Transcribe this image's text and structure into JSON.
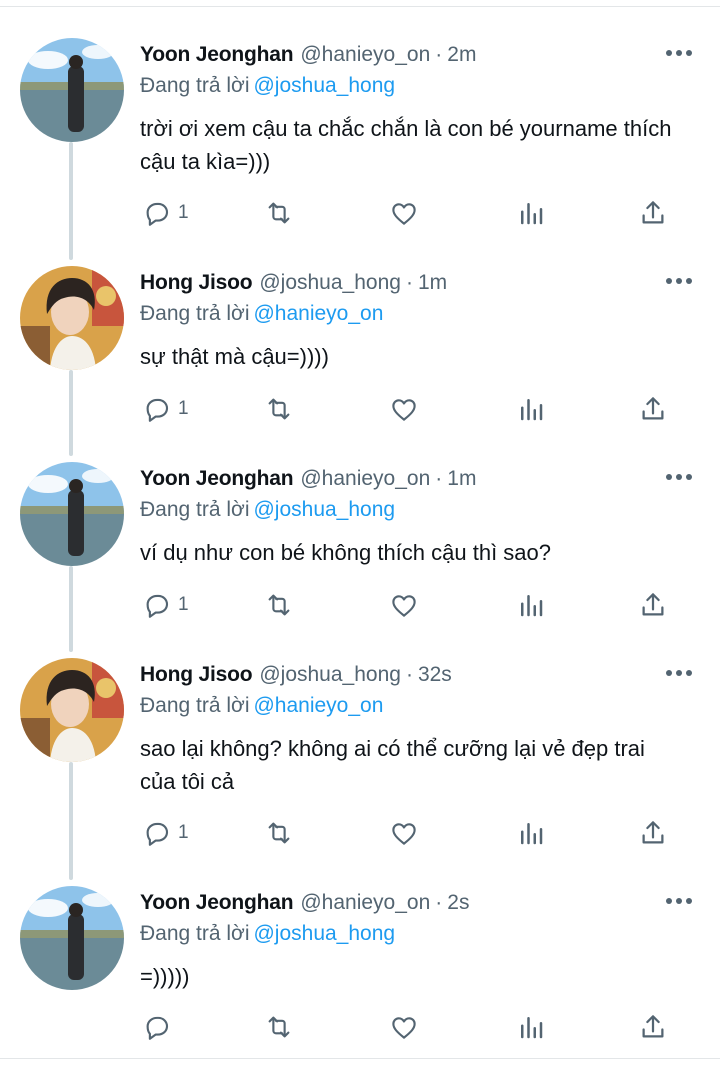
{
  "reply_prefix": "Đang trả lời",
  "colors": {
    "text": "#0f1419",
    "secondary": "#536471",
    "mention": "#1d9bf0",
    "thread_line": "#cfd9de"
  },
  "tweets": [
    {
      "name": "Yoon Jeonghan",
      "handle": "@hanieyo_on",
      "separator": "·",
      "time": "2m",
      "reply_to": "@joshua_hong",
      "text": "trời ơi xem cậu ta chắc chắn là con bé yourname thích cậu ta kìa=)))",
      "reply_count": "1",
      "avatar": "lake-photo"
    },
    {
      "name": "Hong Jisoo",
      "handle": "@joshua_hong",
      "separator": "·",
      "time": "1m",
      "reply_to": "@hanieyo_on",
      "text": "sự thật mà cậu=))))",
      "reply_count": "1",
      "avatar": "portrait-photo"
    },
    {
      "name": "Yoon Jeonghan",
      "handle": "@hanieyo_on",
      "separator": "·",
      "time": "1m",
      "reply_to": "@joshua_hong",
      "text": "ví dụ như con bé không thích cậu thì sao?",
      "reply_count": "1",
      "avatar": "lake-photo"
    },
    {
      "name": "Hong Jisoo",
      "handle": "@joshua_hong",
      "separator": "·",
      "time": "32s",
      "reply_to": "@hanieyo_on",
      "text": "sao lại không? không ai có thể cưỡng lại vẻ đẹp trai của tôi cả",
      "reply_count": "1",
      "avatar": "portrait-photo"
    },
    {
      "name": "Yoon Jeonghan",
      "handle": "@hanieyo_on",
      "separator": "·",
      "time": "2s",
      "reply_to": "@joshua_hong",
      "text": "=)))))",
      "reply_count": "",
      "avatar": "lake-photo"
    }
  ]
}
